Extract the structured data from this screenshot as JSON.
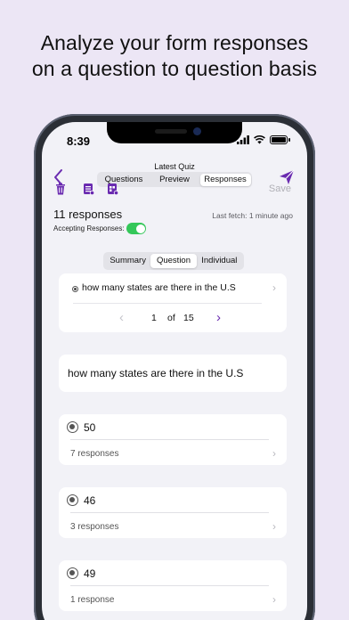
{
  "headline": {
    "line1": "Analyze your form responses",
    "line2": "on a question to question basis"
  },
  "status_bar": {
    "time": "8:39"
  },
  "nav": {
    "title": "Latest Quiz",
    "tabs": [
      {
        "label": "Questions",
        "active": false
      },
      {
        "label": "Preview",
        "active": false
      },
      {
        "label": "Responses",
        "active": true
      }
    ]
  },
  "toolbar": {
    "save_label": "Save"
  },
  "summary": {
    "responses": "11 responses",
    "last_fetch": "Last fetch: 1 minute ago",
    "accepting_label": "Accepting Responses:",
    "accepting_on": true
  },
  "view_tabs": [
    {
      "label": "Summary",
      "active": false
    },
    {
      "label": "Question",
      "active": true
    },
    {
      "label": "Individual",
      "active": false
    }
  ],
  "question_selector": {
    "text": "how many states are there in the U.S",
    "current_page": "1",
    "of_label": "of",
    "total_pages": "15"
  },
  "question_title": "how many states are there in the U.S",
  "options": [
    {
      "value": "50",
      "responses": "7 responses"
    },
    {
      "value": "46",
      "responses": "3 responses"
    },
    {
      "value": "49",
      "responses": "1 response"
    }
  ],
  "colors": {
    "accent": "#6a2bb0",
    "background": "#ece6f5",
    "toggle_on": "#34c759"
  }
}
